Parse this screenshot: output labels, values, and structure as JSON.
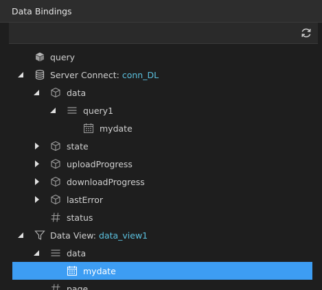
{
  "panel": {
    "title": "Data Bindings"
  },
  "toolbar": {
    "refresh_icon": "refresh-icon"
  },
  "colors": {
    "accent": "#5bc0de",
    "selected": "#3d9df3",
    "background": "#1e1e1e"
  },
  "tree": {
    "query": {
      "label": "query",
      "icon": "cube-icon"
    },
    "server_connect": {
      "label": "Server Connect: ",
      "value": "conn_DL",
      "icon": "database-icon"
    },
    "sc_data": {
      "label": "data",
      "icon": "cube-outline-icon"
    },
    "query1": {
      "label": "query1",
      "icon": "list-icon"
    },
    "sc_mydate": {
      "label": "mydate",
      "icon": "calendar-icon"
    },
    "state": {
      "label": "state",
      "icon": "cube-outline-icon"
    },
    "upload": {
      "label": "uploadProgress",
      "icon": "cube-outline-icon"
    },
    "download": {
      "label": "downloadProgress",
      "icon": "cube-outline-icon"
    },
    "last_error": {
      "label": "lastError",
      "icon": "cube-outline-icon"
    },
    "status": {
      "label": "status",
      "icon": "hash-icon"
    },
    "data_view": {
      "label": "Data View: ",
      "value": "data_view1",
      "icon": "filter-icon"
    },
    "dv_data": {
      "label": "data",
      "icon": "list-icon"
    },
    "dv_mydate": {
      "label": "mydate",
      "icon": "calendar-icon"
    },
    "page": {
      "label": "page",
      "icon": "hash-icon"
    }
  }
}
